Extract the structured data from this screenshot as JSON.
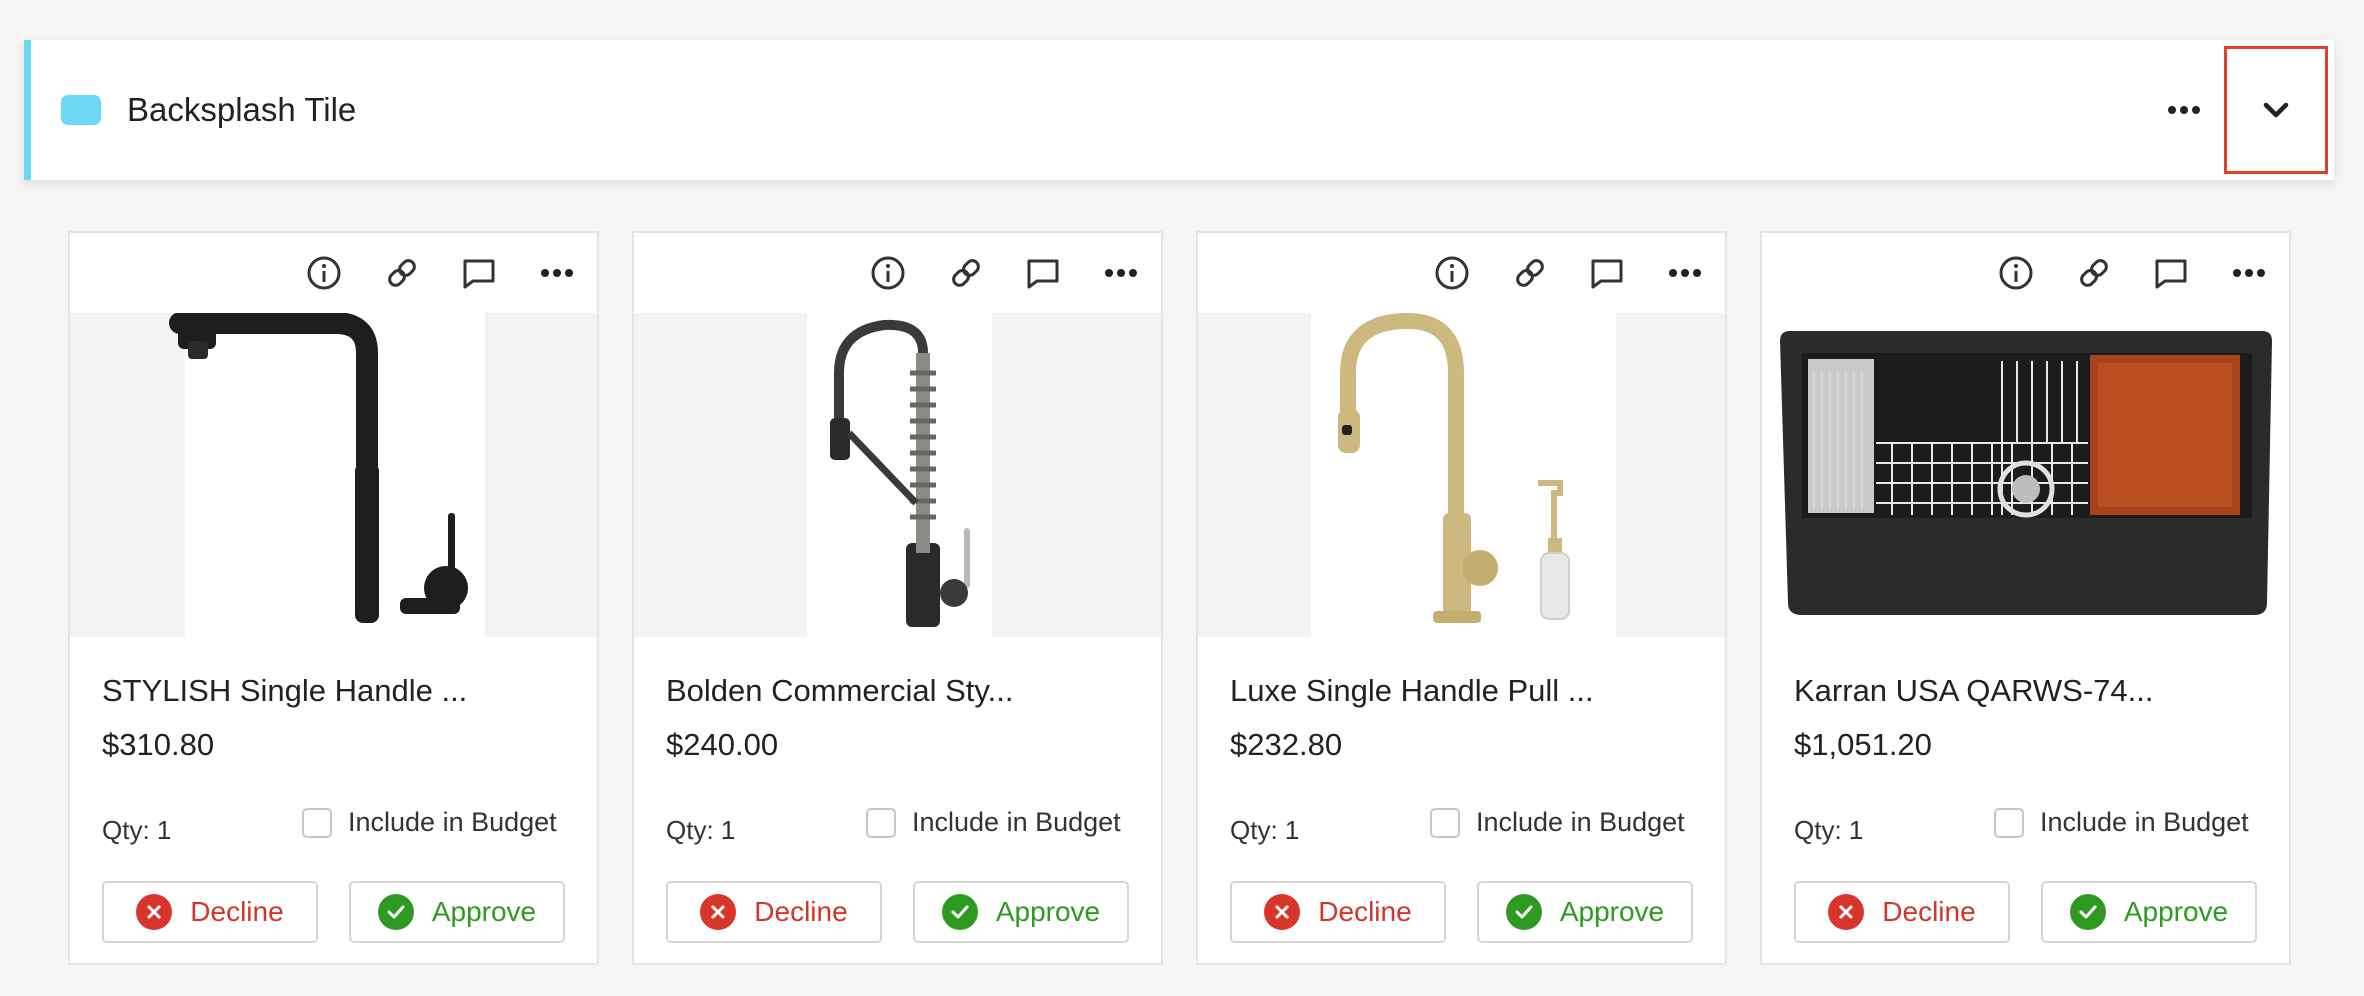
{
  "section": {
    "title": "Backsplash Tile",
    "color": "#6dd8f2",
    "highlight_color": "#e1402b"
  },
  "labels": {
    "qty": "Qty: 1",
    "include_in_budget": "Include in Budget",
    "decline": "Decline",
    "approve": "Approve"
  },
  "products": [
    {
      "title": "STYLISH Single Handle ...",
      "price": "$310.80"
    },
    {
      "title": "Bolden Commercial Sty...",
      "price": "$240.00"
    },
    {
      "title": "Luxe Single Handle Pull ...",
      "price": "$232.80"
    },
    {
      "title": "Karran USA QARWS-74...",
      "price": "$1,051.20"
    }
  ],
  "colors": {
    "decline": "#d9362b",
    "approve": "#2f9a22"
  }
}
